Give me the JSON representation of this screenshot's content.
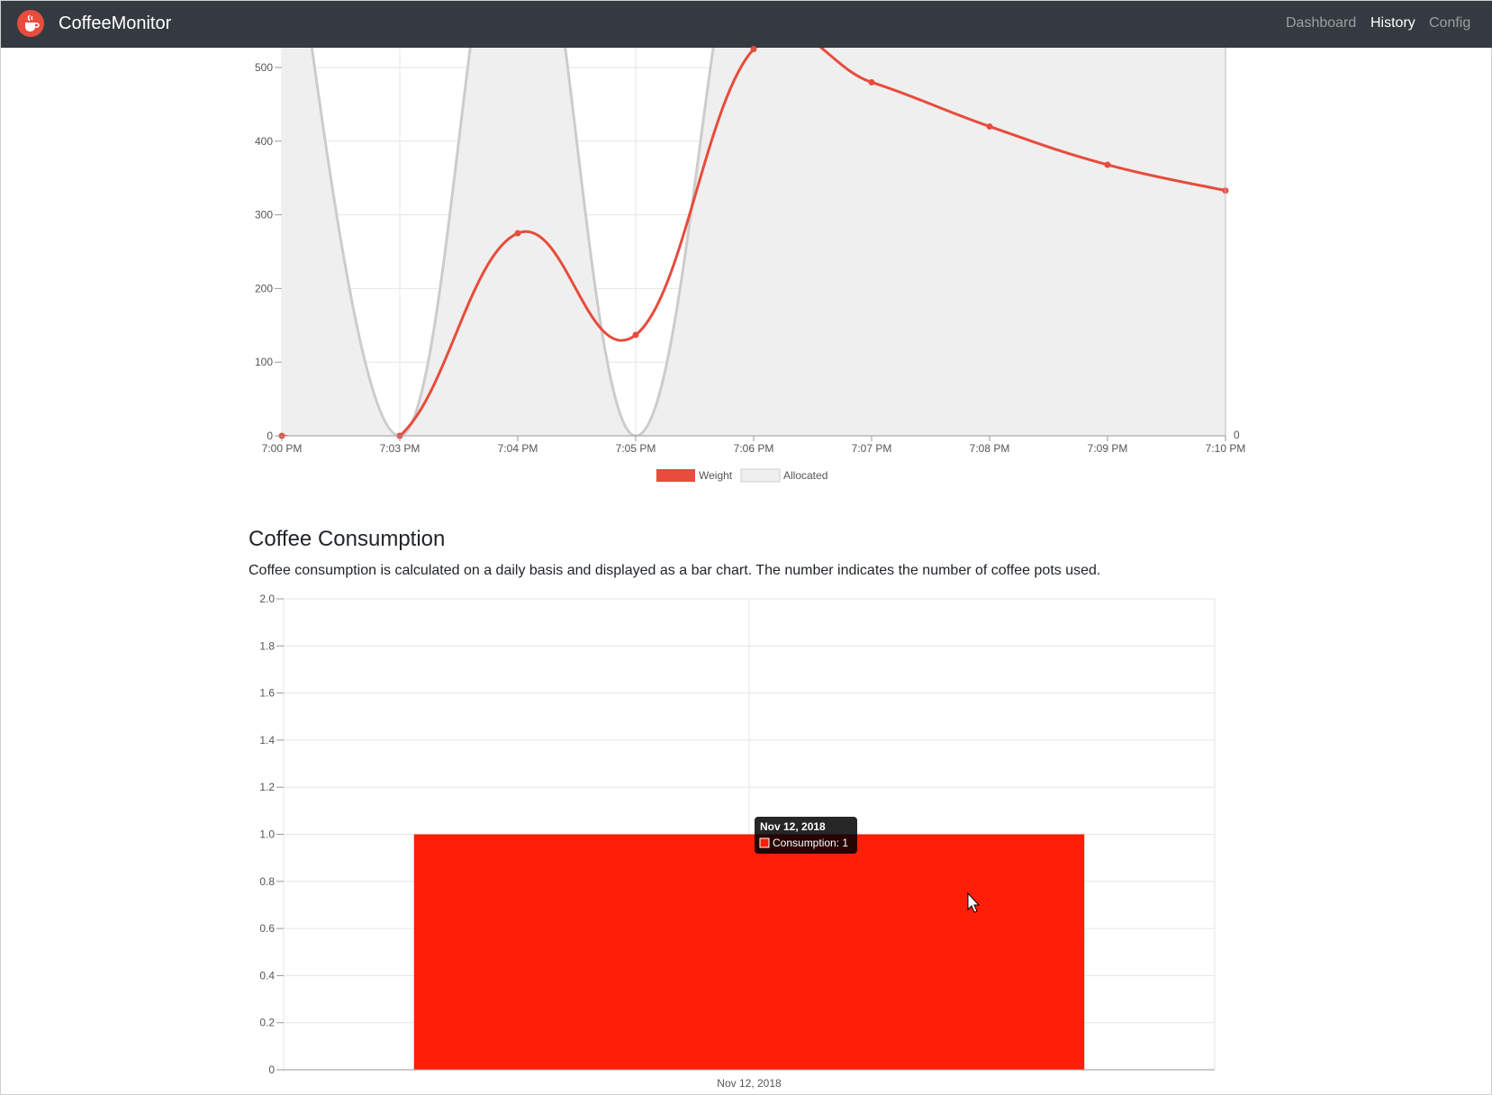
{
  "navbar": {
    "brand": "CoffeeMonitor",
    "logo_icon": "coffee-cup-icon",
    "links": [
      {
        "label": "Dashboard",
        "active": false
      },
      {
        "label": "History",
        "active": true
      },
      {
        "label": "Config",
        "active": false
      }
    ]
  },
  "colors": {
    "navbar_bg": "#343a40",
    "weight_line": "#e74c3c",
    "allocated_fill": "#efefef",
    "allocated_line": "#cccccc",
    "consumption_bar": "#ff1e07"
  },
  "weight_chart": {
    "type": "line",
    "x_ticks": [
      "7:00 PM",
      "7:03 PM",
      "7:04 PM",
      "7:05 PM",
      "7:06 PM",
      "7:07 PM",
      "7:08 PM",
      "7:09 PM",
      "7:10 PM"
    ],
    "y_ticks": [
      "0",
      "100",
      "200",
      "300",
      "400",
      "500"
    ],
    "y_right_tick": "0",
    "legend": [
      "Weight",
      "Allocated"
    ]
  },
  "consumption": {
    "title": "Coffee Consumption",
    "description": "Coffee consumption is calculated on a daily basis and displayed as a bar chart. The number indicates the number of coffee pots used.",
    "tooltip_title": "Nov 12, 2018",
    "tooltip_label": "Consumption: 1"
  },
  "chart_data": [
    {
      "type": "line",
      "categories": [
        "7:00 PM",
        "7:03 PM",
        "7:04 PM",
        "7:05 PM",
        "7:06 PM",
        "7:07 PM",
        "7:08 PM",
        "7:09 PM",
        "7:10 PM"
      ],
      "series": [
        {
          "name": "Weight",
          "values": [
            0,
            0,
            275,
            137,
            525,
            480,
            420,
            368,
            333
          ]
        },
        {
          "name": "Allocated",
          "values": [
            800,
            0,
            800,
            0,
            800,
            800,
            800,
            800,
            800
          ]
        }
      ],
      "ylim": [
        0,
        500
      ],
      "y_ticks": [
        0,
        100,
        200,
        300,
        400,
        500
      ],
      "grid": true,
      "legend": "bottom"
    },
    {
      "type": "bar",
      "categories": [
        "Nov 12, 2018"
      ],
      "series": [
        {
          "name": "Consumption",
          "values": [
            1
          ]
        }
      ],
      "ylim": [
        0,
        2
      ],
      "y_ticks": [
        "0",
        "0.2",
        "0.4",
        "0.6",
        "0.8",
        "1.0",
        "1.2",
        "1.4",
        "1.6",
        "1.8",
        "2.0"
      ],
      "grid": true
    }
  ]
}
